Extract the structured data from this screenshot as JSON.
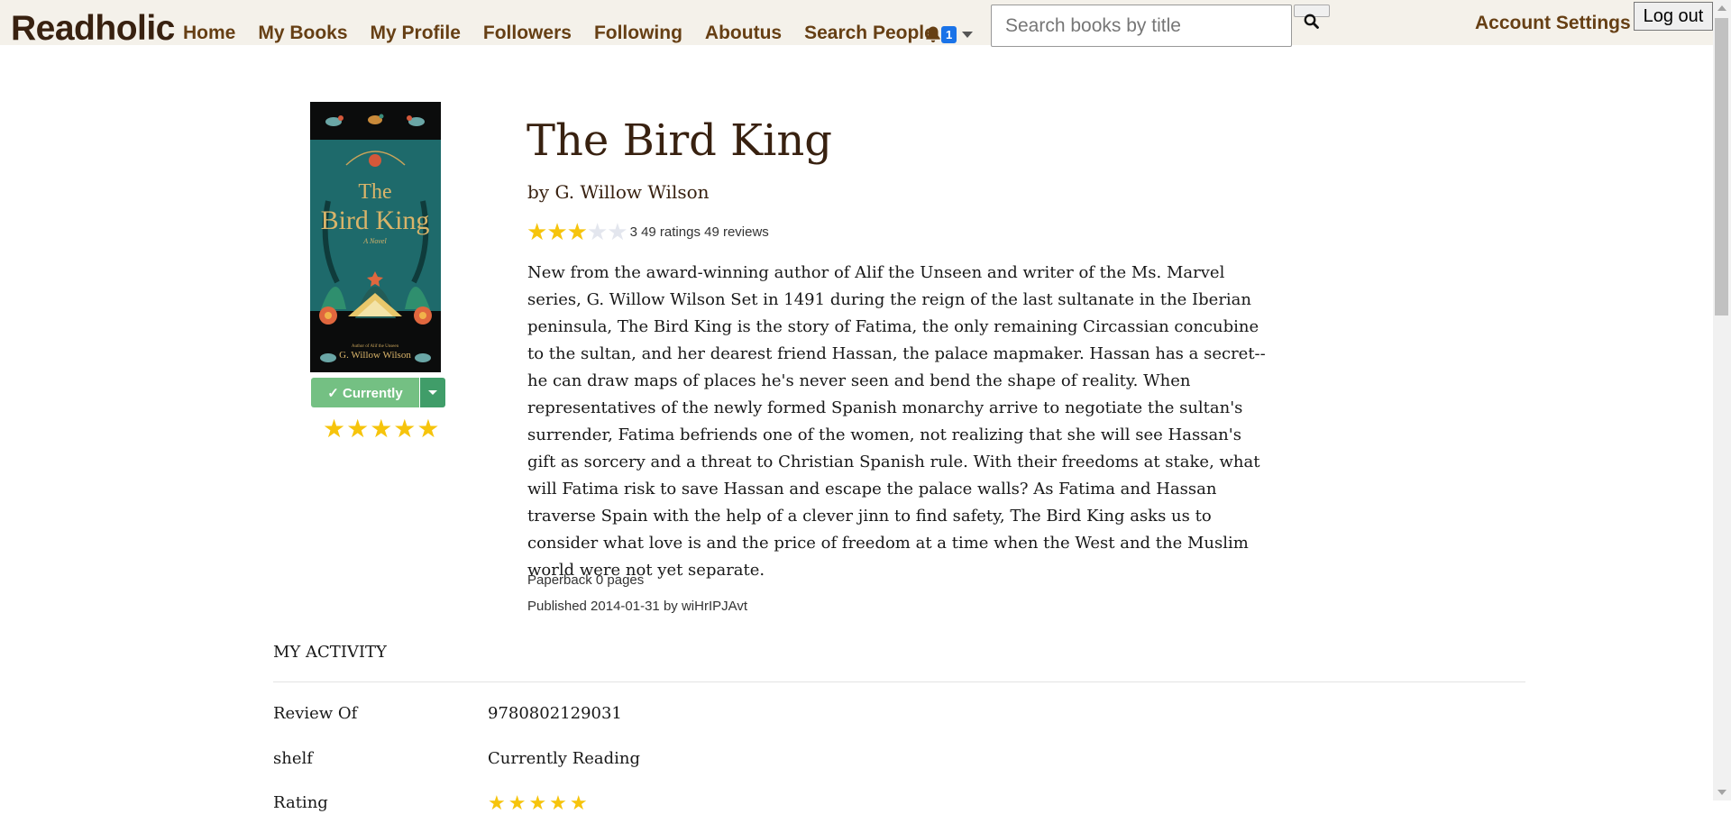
{
  "navbar": {
    "brand": "Readholic",
    "links": [
      "Home",
      "My Books",
      "My Profile",
      "Followers",
      "Following",
      "Aboutus",
      "Search People"
    ],
    "notification_count": "1",
    "search_placeholder": "Search books by title",
    "account_settings": "Account Settings",
    "logout": "Log out"
  },
  "book": {
    "title": "The Bird King",
    "author": "by G. Willow Wilson",
    "rating_text": "3 49 ratings 49 reviews",
    "average_rating": 3,
    "max_rating": 5,
    "description": "New from the award-winning author of Alif the Unseen and writer of the Ms. Marvel series, G. Willow Wilson Set in 1491 during the reign of the last sultanate in the Iberian peninsula, The Bird King is the story of Fatima, the only remaining Circassian concubine to the sultan, and her dearest friend Hassan, the palace mapmaker. Hassan has a secret--he can draw maps of places he's never seen and bend the shape of reality. When representatives of the newly formed Spanish monarchy arrive to negotiate the sultan's surrender, Fatima befriends one of the women, not realizing that she will see Hassan's gift as sorcery and a threat to Christian Spanish rule. With their freedoms at stake, what will Fatima risk to save Hassan and escape the palace walls? As Fatima and Hassan traverse Spain with the help of a clever jinn to find safety, The Bird King asks us to consider what love is and the price of freedom at a time when the West and the Muslim world were not yet separate.",
    "format": "Paperback 0 pages",
    "published": "Published 2014-01-31 by wiHrIPJAvt",
    "shelf_button": "✓ Currently",
    "user_rating_stars": "★★★★★",
    "cover": {
      "title_line1": "The",
      "title_line2": "Bird King",
      "subtitle": "A Novel",
      "tagline": "Author of Alif the Unseen",
      "author": "G. Willow Wilson"
    }
  },
  "activity": {
    "heading": "MY ACTIVITY",
    "rows": [
      {
        "label": "Review Of",
        "value": "9780802129031"
      },
      {
        "label": "shelf",
        "value": "Currently Reading"
      },
      {
        "label": "Rating",
        "value": "★★★★★"
      }
    ]
  },
  "colors": {
    "navbar_bg": "#f4f1ea",
    "brand": "#382110",
    "nav_link": "#663f14",
    "star": "#f6c40c",
    "shelf_button": "#74c083",
    "badge": "#1a73e8"
  }
}
